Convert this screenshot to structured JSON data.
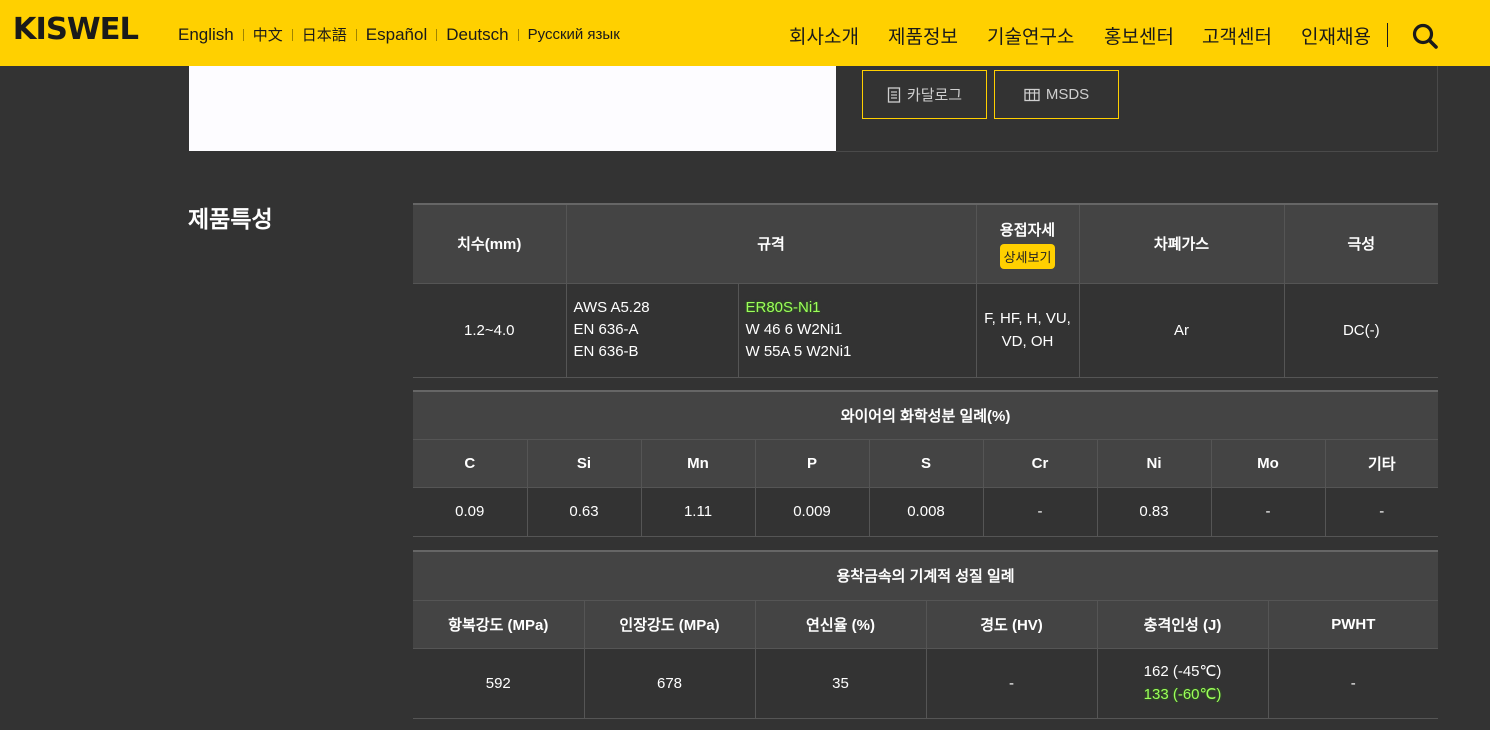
{
  "header": {
    "logo": "KISWEL",
    "languages": [
      "English",
      "中文",
      "日本語",
      "Español",
      "Deutsch",
      "Русский язык"
    ],
    "nav": [
      "회사소개",
      "제품정보",
      "기술연구소",
      "홍보센터",
      "고객센터",
      "인재채용"
    ],
    "colors": {
      "accent": "#ffd000",
      "background": "#333333"
    }
  },
  "downloads": {
    "catalog": "카달로그",
    "msds": "MSDS"
  },
  "section_title": "제품특성",
  "spec_table": {
    "headers": {
      "size": "치수(mm)",
      "standard": "규격",
      "position": "용접자세",
      "position_badge": "상세보기",
      "gas": "차폐가스",
      "polarity": "극성"
    },
    "row": {
      "size": "1.2~4.0",
      "standards_left": [
        "AWS A5.28",
        "EN 636-A",
        "EN 636-B"
      ],
      "standards_right": [
        "ER80S-Ni1",
        "W 46 6 W2Ni1",
        "W 55A 5 W2Ni1"
      ],
      "position_1": "F, HF, H, VU,",
      "position_2": "VD, OH",
      "gas": "Ar",
      "polarity": "DC(-)"
    }
  },
  "chem_table": {
    "title": "와이어의 화학성분 일례(%)",
    "headers": [
      "C",
      "Si",
      "Mn",
      "P",
      "S",
      "Cr",
      "Ni",
      "Mo",
      "기타"
    ],
    "values": [
      "0.09",
      "0.63",
      "1.11",
      "0.009",
      "0.008",
      "-",
      "0.83",
      "-",
      "-"
    ]
  },
  "mech_table": {
    "title": "용착금속의 기계적 성질 일례",
    "headers": [
      "항복강도 (MPa)",
      "인장강도 (MPa)",
      "연신율 (%)",
      "경도 (HV)",
      "충격인성 (J)",
      "PWHT"
    ],
    "values": {
      "yield": "592",
      "tensile": "678",
      "elongation": "35",
      "hardness": "-",
      "impact_1": "162 (-45℃)",
      "impact_2": "133 (-60℃)",
      "pwht": "-"
    }
  }
}
